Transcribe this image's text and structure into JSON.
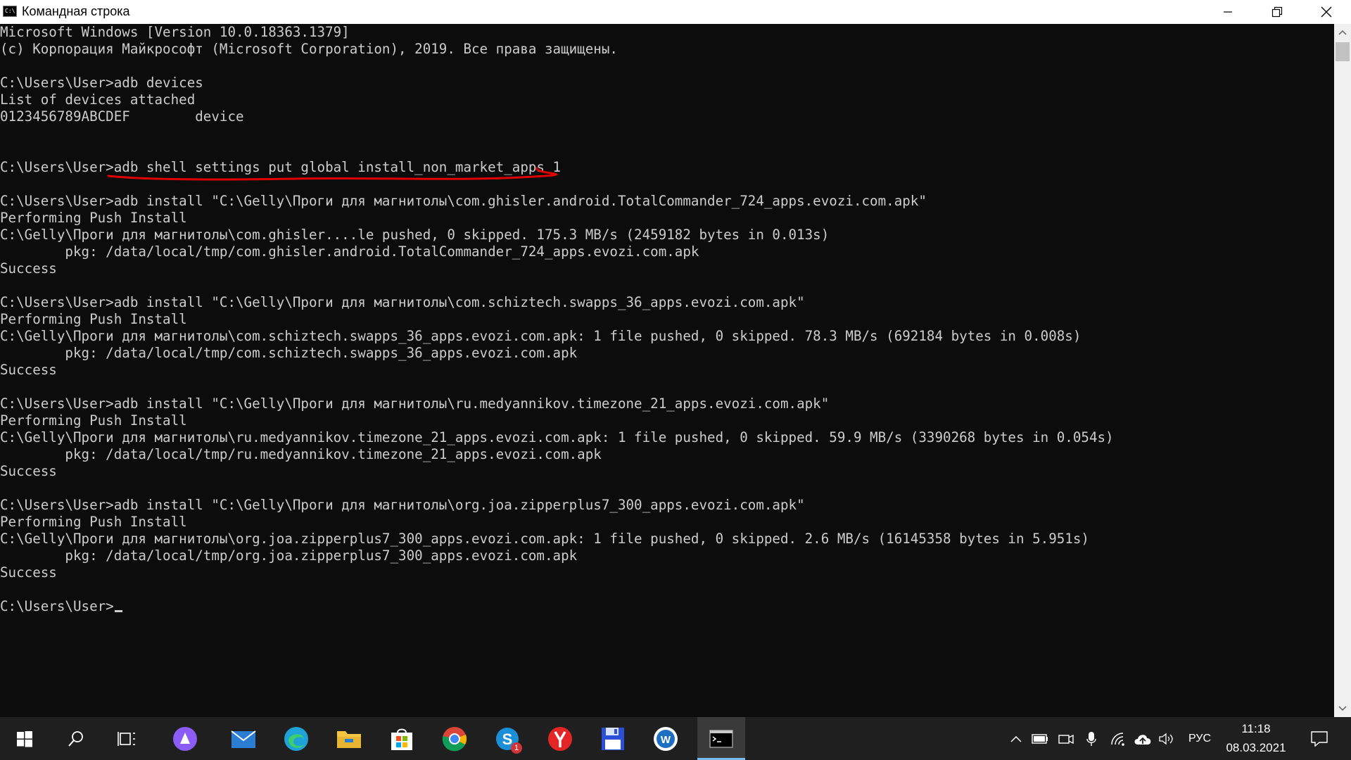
{
  "window": {
    "title": "Командная строка",
    "app_icon_text": "C:\\",
    "controls": {
      "minimize_icon": "minimize-icon",
      "maximize_icon": "restore-icon",
      "close_icon": "close-icon"
    }
  },
  "console": {
    "lines": [
      "Microsoft Windows [Version 10.0.18363.1379]",
      "(c) Корпорация Майкрософт (Microsoft Corporation), 2019. Все права защищены.",
      "",
      "C:\\Users\\User>adb devices",
      "List of devices attached",
      "0123456789ABCDEF        device",
      "",
      "",
      "C:\\Users\\User>adb shell settings put global install_non_market_apps 1",
      "",
      "C:\\Users\\User>adb install \"C:\\Gelly\\Проги для магнитолы\\com.ghisler.android.TotalCommander_724_apps.evozi.com.apk\"",
      "Performing Push Install",
      "C:\\Gelly\\Проги для магнитолы\\com.ghisler....le pushed, 0 skipped. 175.3 MB/s (2459182 bytes in 0.013s)",
      "        pkg: /data/local/tmp/com.ghisler.android.TotalCommander_724_apps.evozi.com.apk",
      "Success",
      "",
      "C:\\Users\\User>adb install \"C:\\Gelly\\Проги для магнитолы\\com.schiztech.swapps_36_apps.evozi.com.apk\"",
      "Performing Push Install",
      "C:\\Gelly\\Проги для магнитолы\\com.schiztech.swapps_36_apps.evozi.com.apk: 1 file pushed, 0 skipped. 78.3 MB/s (692184 bytes in 0.008s)",
      "        pkg: /data/local/tmp/com.schiztech.swapps_36_apps.evozi.com.apk",
      "Success",
      "",
      "C:\\Users\\User>adb install \"C:\\Gelly\\Проги для магнитолы\\ru.medyannikov.timezone_21_apps.evozi.com.apk\"",
      "Performing Push Install",
      "C:\\Gelly\\Проги для магнитолы\\ru.medyannikov.timezone_21_apps.evozi.com.apk: 1 file pushed, 0 skipped. 59.9 MB/s (3390268 bytes in 0.054s)",
      "        pkg: /data/local/tmp/ru.medyannikov.timezone_21_apps.evozi.com.apk",
      "Success",
      "",
      "C:\\Users\\User>adb install \"C:\\Gelly\\Проги для магнитолы\\org.joa.zipperplus7_300_apps.evozi.com.apk\"",
      "Performing Push Install",
      "C:\\Gelly\\Проги для магнитолы\\org.joa.zipperplus7_300_apps.evozi.com.apk: 1 file pushed, 0 skipped. 2.6 MB/s (16145358 bytes in 5.951s)",
      "        pkg: /data/local/tmp/org.joa.zipperplus7_300_apps.evozi.com.apk",
      "Success",
      "",
      "C:\\Users\\User>"
    ],
    "annotation_color": "#e00000",
    "text_color": "#cccccc",
    "background": "#0c0c0c"
  },
  "taskbar": {
    "apps": [
      {
        "name": "start-button",
        "icon": "windows-logo-icon"
      },
      {
        "name": "search-button",
        "icon": "search-icon"
      },
      {
        "name": "task-view-button",
        "icon": "task-view-icon"
      },
      {
        "name": "alice-assistant",
        "icon": "alice-icon",
        "color": "#8c5cf6"
      },
      {
        "name": "mail-app",
        "icon": "mail-icon",
        "color": "#2b7cd3"
      },
      {
        "name": "edge-browser",
        "icon": "edge-icon",
        "color": "#1fa2d8"
      },
      {
        "name": "file-explorer",
        "icon": "folder-icon",
        "color": "#f4c542"
      },
      {
        "name": "microsoft-store",
        "icon": "store-icon",
        "color": "#ffffff"
      },
      {
        "name": "chrome-browser",
        "icon": "chrome-icon"
      },
      {
        "name": "skype-app",
        "icon": "skype-icon",
        "color": "#1a8fd8",
        "badge": "1"
      },
      {
        "name": "yandex-browser",
        "icon": "yandex-icon",
        "color": "#e32525"
      },
      {
        "name": "save-app",
        "icon": "floppy-disk-icon",
        "color": "#2b4fd6"
      },
      {
        "name": "word-app",
        "icon": "word-icon",
        "color": "#1d6fc1"
      },
      {
        "name": "command-prompt",
        "icon": "terminal-icon",
        "active": true
      }
    ],
    "tray": {
      "language": "РУС",
      "time": "11:18",
      "date": "08.03.2021",
      "icons": [
        "chevron-up-icon",
        "battery-icon",
        "camera-icon",
        "microphone-icon",
        "wifi-icon",
        "cloud-upload-icon",
        "volume-icon",
        "notifications-icon"
      ]
    }
  }
}
